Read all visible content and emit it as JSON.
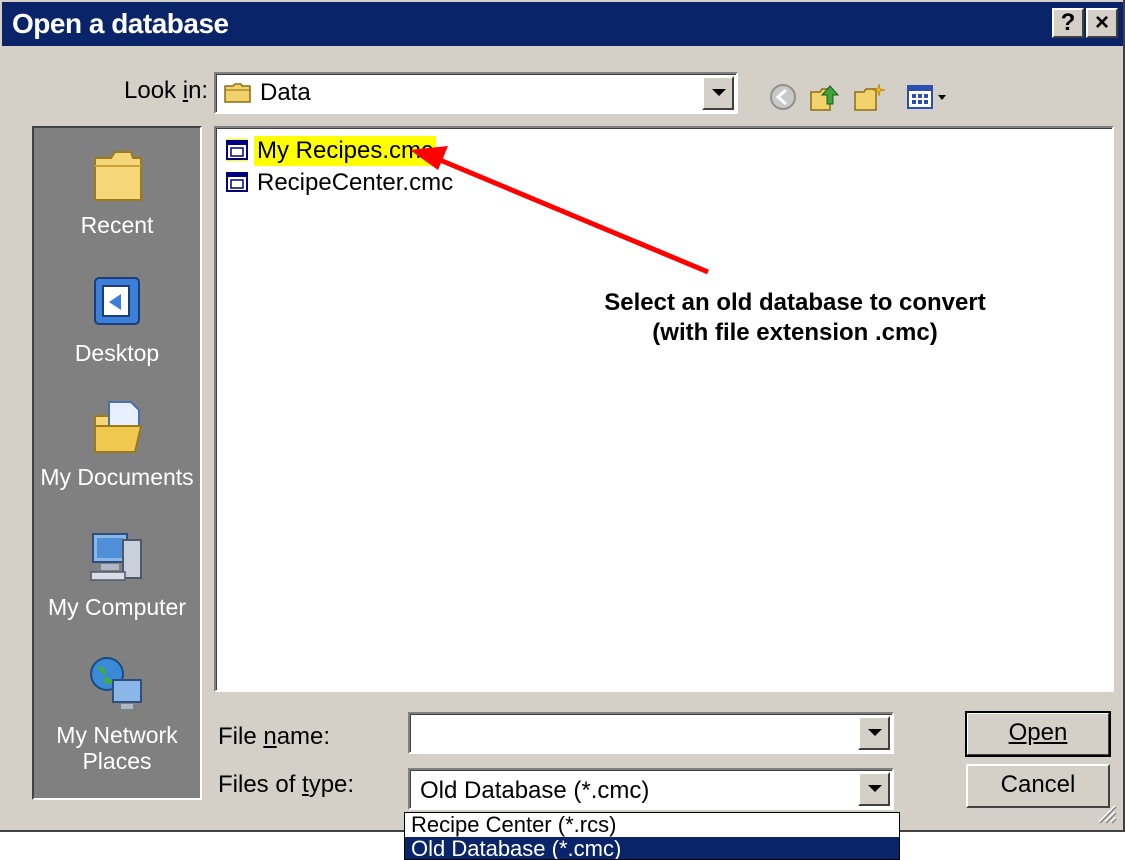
{
  "window": {
    "title": "Open a database",
    "help_label": "?",
    "close_label": "×"
  },
  "lookin": {
    "label": "Look in:",
    "value": "Data"
  },
  "places": [
    {
      "label": "Recent",
      "icon": "recent-folder-icon"
    },
    {
      "label": "Desktop",
      "icon": "desktop-icon"
    },
    {
      "label": "My Documents",
      "icon": "my-documents-icon"
    },
    {
      "label": "My Computer",
      "icon": "my-computer-icon"
    },
    {
      "label": "My Network Places",
      "icon": "network-places-icon"
    }
  ],
  "files": [
    {
      "name": "My Recipes.cmc",
      "highlighted": true
    },
    {
      "name": "RecipeCenter.cmc",
      "highlighted": false
    }
  ],
  "annotation": {
    "text": "Select an old database to convert (with file extension .cmc)",
    "color": "#ff0000"
  },
  "filename": {
    "label": "File name:",
    "value": ""
  },
  "filetype": {
    "label": "Files of type:",
    "value": "Old Database (*.cmc)",
    "options": [
      "Recipe Center (*.rcs)",
      "Old Database (*.cmc)"
    ],
    "highlighted_option": "Old Database (*.cmc)"
  },
  "buttons": {
    "open": "Open",
    "cancel": "Cancel"
  },
  "colors": {
    "titlebar": "#0a246a",
    "face": "#d4d0c8",
    "highlight": "#ffff00"
  }
}
